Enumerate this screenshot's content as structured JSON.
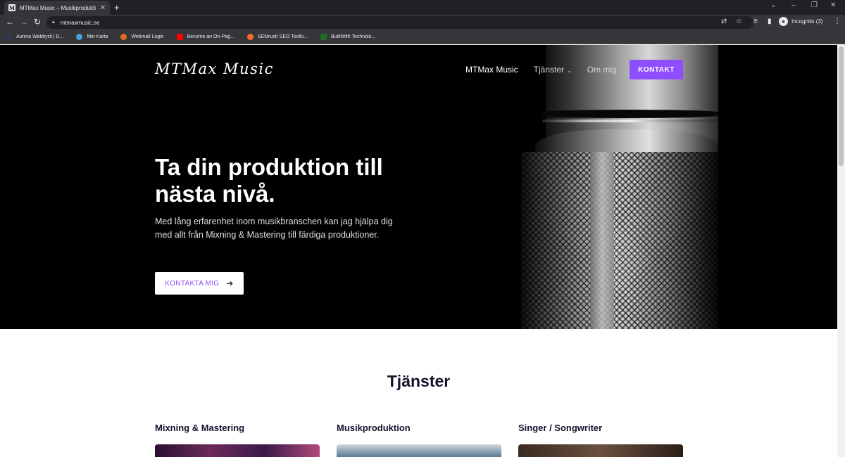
{
  "browser": {
    "tab_title": "MTMax Music – Musikproduktion",
    "tab_favicon": "M",
    "url": "mtmaxmusic.se",
    "incognito_label": "Incognito (3)",
    "bookmarks": [
      {
        "label": "Aurora Webbyrå | D...",
        "color": "#2f3a5a"
      },
      {
        "label": "Min Karta",
        "color": "#4aa3df"
      },
      {
        "label": "Webmail Login",
        "color": "#e36a1c"
      },
      {
        "label": "Become an On-Pag...",
        "color": "#ff0000"
      },
      {
        "label": "SEMrush SEO Toolki...",
        "color": "#ff642d"
      },
      {
        "label": "BuiltWith Technolo...",
        "color": "#1e6b2a"
      }
    ]
  },
  "site": {
    "logo": "MTMax Music",
    "nav": [
      {
        "label": "MTMax Music",
        "active": true
      },
      {
        "label": "Tjänster",
        "has_dropdown": true
      },
      {
        "label": "Om mig"
      }
    ],
    "cta": "KONTAKT",
    "hero": {
      "title_line1": "Ta din produktion till",
      "title_line2": "nästa nivå.",
      "text": "Med lång erfarenhet inom musikbranschen kan jag hjälpa dig med allt från Mixning & Mastering till färdiga produktioner.",
      "button": "KONTAKTA MIG"
    },
    "services": {
      "title": "Tjänster",
      "items": [
        {
          "name": "Mixning & Mastering"
        },
        {
          "name": "Musikproduktion"
        },
        {
          "name": "Singer / Songwriter"
        }
      ]
    },
    "colors": {
      "accent": "#8e4dff",
      "heading": "#16122b"
    }
  }
}
